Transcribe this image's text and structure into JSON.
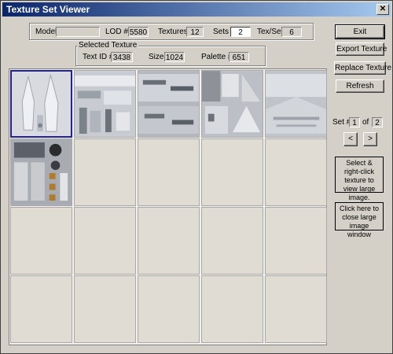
{
  "window": {
    "title": "Texture Set Viewer",
    "close_glyph": "✕"
  },
  "info": {
    "model_label": "Model",
    "model_value": "",
    "lod_label": "LOD #",
    "lod_value": "5580",
    "textures_label": "Textures",
    "textures_value": "12",
    "sets_label": "Sets",
    "sets_value": "2",
    "texset_label": "Tex/Set",
    "texset_value": "6"
  },
  "selected": {
    "legend": "Selected Texture",
    "textid_label": "Text ID #",
    "textid_value": "3438",
    "size_label": "Size",
    "size_value": "1024",
    "palette_label": "Palette #",
    "palette_value": "651"
  },
  "buttons": {
    "exit": "Exit",
    "export": "Export Texture",
    "replace": "Replace Texture",
    "refresh": "Refresh"
  },
  "set_nav": {
    "label": "Set #",
    "current": "1",
    "of_label": "of",
    "total": "2",
    "prev_glyph": "<",
    "next_glyph": ">"
  },
  "notes": {
    "select": "Select & right-click texture to view large image.",
    "close": "Click here to close large image window"
  },
  "colors": {
    "selection_border": "#2020a0",
    "title_start": "#0a246a",
    "title_end": "#a6caf0"
  }
}
